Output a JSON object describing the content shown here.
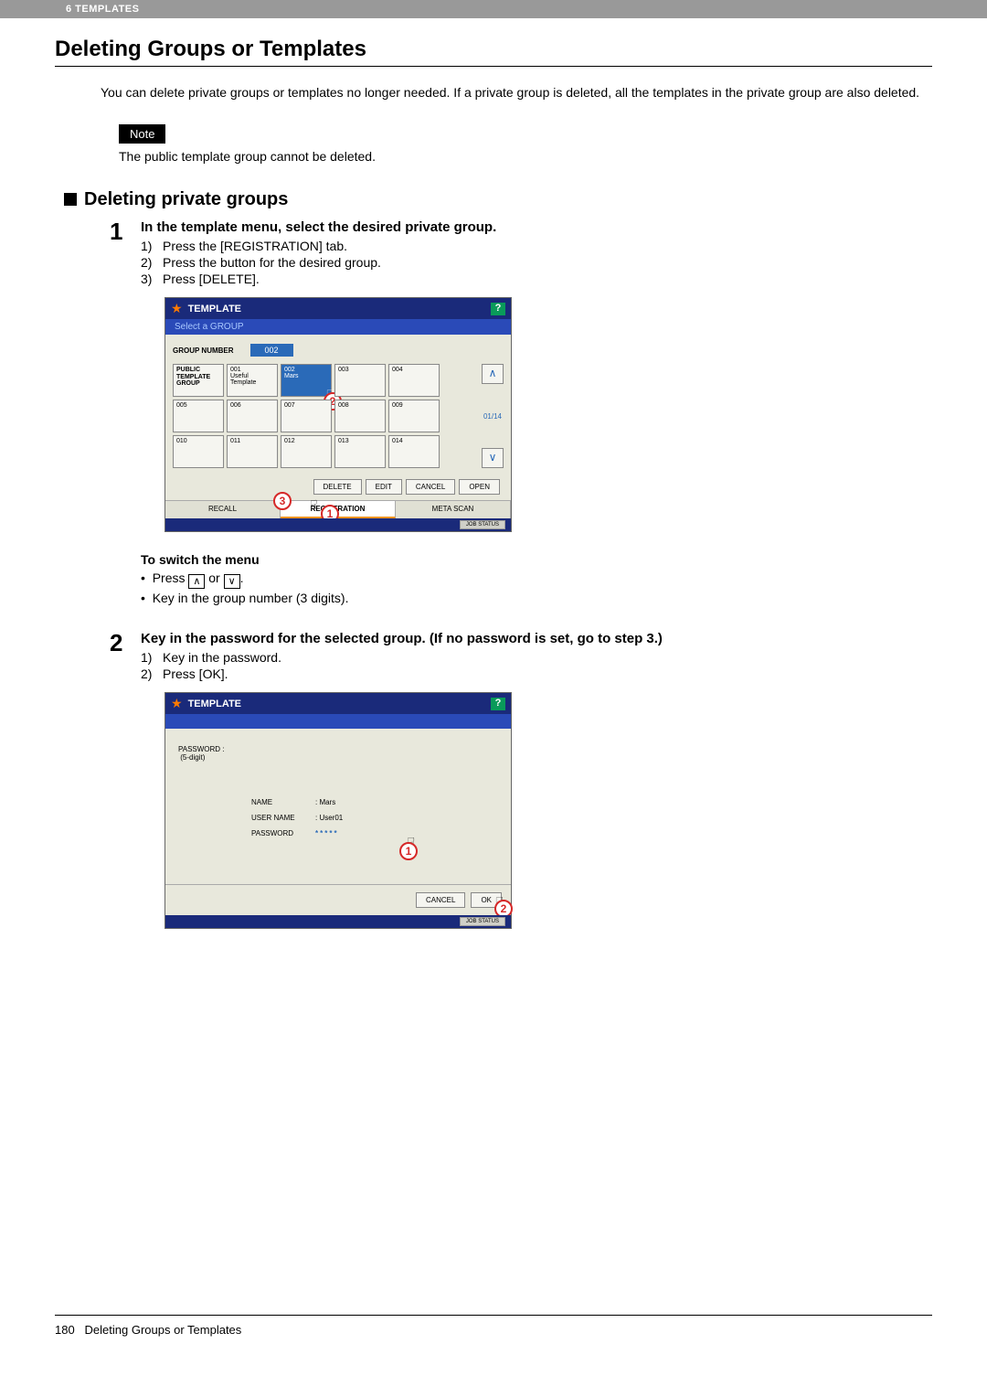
{
  "header": {
    "chapter": "6 TEMPLATES"
  },
  "title": "Deleting Groups or Templates",
  "intro": "You can delete private groups or templates no longer needed. If a private group is deleted, all the templates in the private group are also deleted.",
  "note": {
    "label": "Note",
    "text": "The public template group cannot be deleted."
  },
  "section": "Deleting private groups",
  "step1": {
    "num": "1",
    "title": "In the template menu, select the desired private group.",
    "items": [
      {
        "n": "1)",
        "t": "Press the [REGISTRATION] tab."
      },
      {
        "n": "2)",
        "t": "Press the button for the desired group."
      },
      {
        "n": "3)",
        "t": "Press [DELETE]."
      }
    ]
  },
  "shot1": {
    "title": "TEMPLATE",
    "subtitle": "Select a GROUP",
    "groupnum_label": "GROUP NUMBER",
    "groupnum_val": "002",
    "public_cell": "PUBLIC TEMPLATE GROUP",
    "cells": [
      {
        "n": "001",
        "name": "Useful Template"
      },
      {
        "n": "002",
        "name": "Mars"
      },
      {
        "n": "003",
        "name": ""
      },
      {
        "n": "004",
        "name": ""
      },
      {
        "n": "005",
        "name": ""
      },
      {
        "n": "006",
        "name": ""
      },
      {
        "n": "007",
        "name": ""
      },
      {
        "n": "008",
        "name": ""
      },
      {
        "n": "009",
        "name": ""
      },
      {
        "n": "010",
        "name": ""
      },
      {
        "n": "011",
        "name": ""
      },
      {
        "n": "012",
        "name": ""
      },
      {
        "n": "013",
        "name": ""
      },
      {
        "n": "014",
        "name": ""
      }
    ],
    "page": "01/14",
    "btns": {
      "delete": "DELETE",
      "edit": "EDIT",
      "cancel": "CANCEL",
      "open": "OPEN"
    },
    "tabs": {
      "recall": "RECALL",
      "registration": "REGISTRATION",
      "metascan": "META SCAN"
    },
    "jobstatus": "JOB STATUS"
  },
  "switch": {
    "title": "To switch the menu",
    "b1a": "Press ",
    "b1b": " or ",
    "b1c": ".",
    "b2": "Key in the group number (3 digits)."
  },
  "step2": {
    "num": "2",
    "title": "Key in the password for the selected group. (If no password is set, go to step 3.)",
    "items": [
      {
        "n": "1)",
        "t": "Key in the password."
      },
      {
        "n": "2)",
        "t": "Press [OK]."
      }
    ]
  },
  "shot2": {
    "title": "TEMPLATE",
    "pwd_label": "PASSWORD :",
    "pwd_hint": "(5-digit)",
    "name_k": "NAME",
    "name_v": ": Mars",
    "user_k": "USER NAME",
    "user_v": ": User01",
    "pass_k": "PASSWORD",
    "pass_v": "*****",
    "cancel": "CANCEL",
    "ok": "OK",
    "jobstatus": "JOB STATUS"
  },
  "footer": {
    "page": "180",
    "title": "Deleting Groups or Templates"
  }
}
